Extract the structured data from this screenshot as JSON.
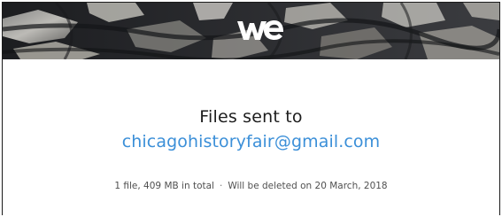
{
  "header": {
    "logo_icon": "wetransfer-logo-icon",
    "background_image": "dark-rock-texture"
  },
  "message": {
    "headline": "Files sent to",
    "recipient_email": "chicagohistoryfair@gmail.com",
    "file_summary": "1 file, 409 MB in total",
    "separator": "·",
    "expiry_text": "Will be deleted on 20 March, 2018"
  },
  "colors": {
    "recipient_link": "#3b8fd8",
    "headline_text": "#1d1d1d",
    "meta_text": "#505050"
  }
}
